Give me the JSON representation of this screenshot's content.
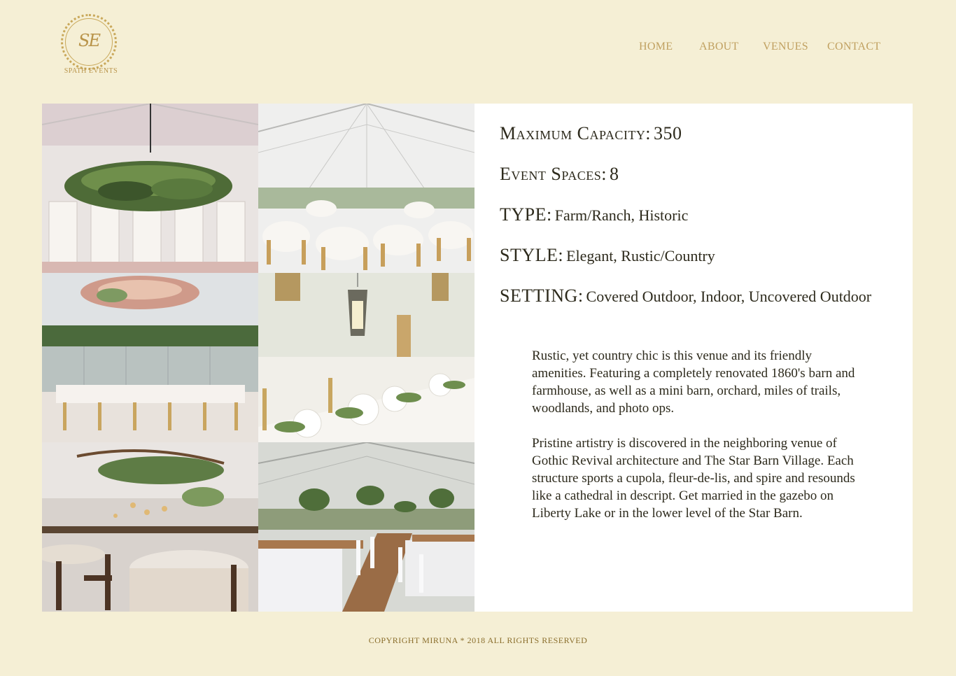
{
  "brand": {
    "monogram": "SE",
    "name": "SPATH EVENTS",
    "accent_color": "#c0a060"
  },
  "nav": {
    "items": [
      {
        "label": "HOME"
      },
      {
        "label": "ABOUT"
      },
      {
        "label": "VENUES"
      },
      {
        "label": "CONTACT"
      }
    ]
  },
  "gallery": {
    "photos": [
      {
        "icon": "greenery-chandelier-photo"
      },
      {
        "icon": "clear-tent-reception-photo"
      },
      {
        "icon": "floral-chandelier-tent-photo"
      },
      {
        "icon": "lantern-tablescape-photo"
      },
      {
        "icon": "hanging-greenery-reception-photo"
      },
      {
        "icon": "long-tables-tent-photo"
      }
    ]
  },
  "venue": {
    "capacity": {
      "label": "Maximum Capacity:",
      "value": "350"
    },
    "spaces": {
      "label": "Event Spaces:",
      "value": "8"
    },
    "type": {
      "label": "TYPE:",
      "value": "Farm/Ranch, Historic"
    },
    "style": {
      "label": "STYLE:",
      "value": "Elegant, Rustic/Country"
    },
    "setting": {
      "label": "SETTING:",
      "value": "Covered Outdoor, Indoor, Uncovered Outdoor"
    },
    "description": [
      "Rustic, yet country chic is this venue and its friendly amenities. Featuring a completely renovated 1860's barn and farmhouse, as well as a mini barn, orchard, miles of trails, woodlands, and photo ops.",
      "Pristine artistry is discovered in the neighboring venue of Gothic Revival architecture and The Star Barn Village. Each structure sports a cupola, fleur-de-lis, and spire and resounds like a cathedral in descript. Get married in the gazebo on Liberty Lake or in the lower level of the Star Barn."
    ]
  },
  "footer": {
    "text": "COPYRIGHT MIRUNA * 2018 ALL RIGHTS RESERVED"
  }
}
